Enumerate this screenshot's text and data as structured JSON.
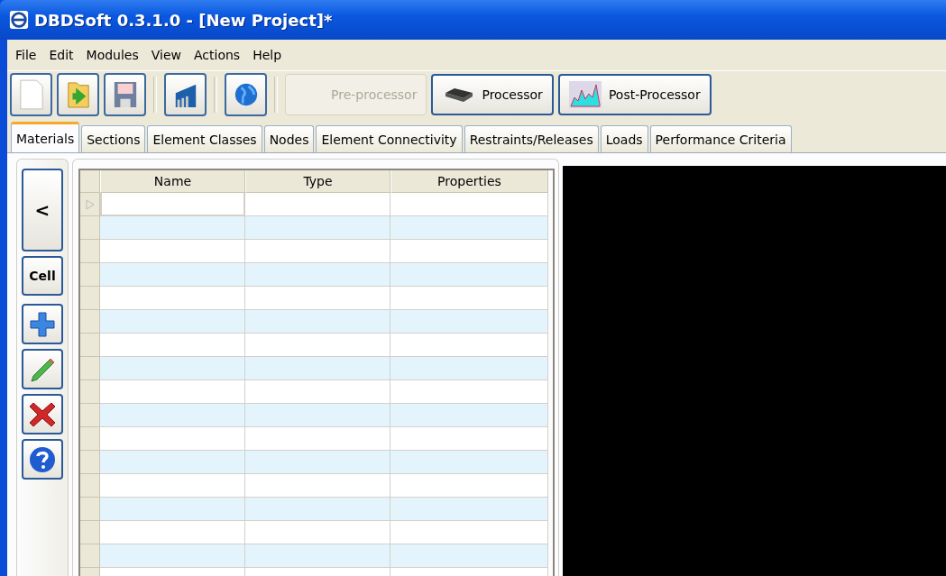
{
  "window": {
    "title": "DBDSoft 0.3.1.0 - [New Project]*"
  },
  "menu": [
    "File",
    "Edit",
    "Modules",
    "View",
    "Actions",
    "Help"
  ],
  "toolbar": [
    {
      "kind": "new"
    },
    {
      "kind": "open"
    },
    {
      "kind": "save"
    },
    {
      "kind": "building"
    },
    {
      "kind": "globe"
    }
  ],
  "modules": [
    {
      "label": "Pre-processor",
      "kind": "none",
      "disabled": true
    },
    {
      "label": "Processor",
      "kind": "chip",
      "disabled": false
    },
    {
      "label": "Post-Processor",
      "kind": "chart",
      "disabled": false
    }
  ],
  "tabs": [
    {
      "label": "Materials",
      "selected": true
    },
    {
      "label": "Sections",
      "selected": false
    },
    {
      "label": "Element Classes",
      "selected": false
    },
    {
      "label": "Nodes",
      "selected": false
    },
    {
      "label": "Element Connectivity",
      "selected": false
    },
    {
      "label": "Restraints/Releases",
      "selected": false
    },
    {
      "label": "Loads",
      "selected": false
    },
    {
      "label": "Performance Criteria",
      "selected": false
    }
  ],
  "side_buttons": [
    {
      "label": "<"
    },
    {
      "label": "Cell"
    }
  ],
  "side_tools": [
    {
      "kind": "add"
    },
    {
      "kind": "edit"
    },
    {
      "kind": "delete"
    },
    {
      "kind": "help"
    }
  ],
  "table": {
    "columns": [
      "Name",
      "Type",
      "Properties"
    ],
    "rows": [
      {
        "selected": true
      },
      {
        "selected": false
      },
      {
        "selected": false
      },
      {
        "selected": false
      },
      {
        "selected": false
      },
      {
        "selected": false
      },
      {
        "selected": false
      },
      {
        "selected": false
      },
      {
        "selected": false
      },
      {
        "selected": false
      },
      {
        "selected": false
      },
      {
        "selected": false
      },
      {
        "selected": false
      },
      {
        "selected": false
      },
      {
        "selected": false
      },
      {
        "selected": false
      },
      {
        "selected": false
      }
    ]
  }
}
